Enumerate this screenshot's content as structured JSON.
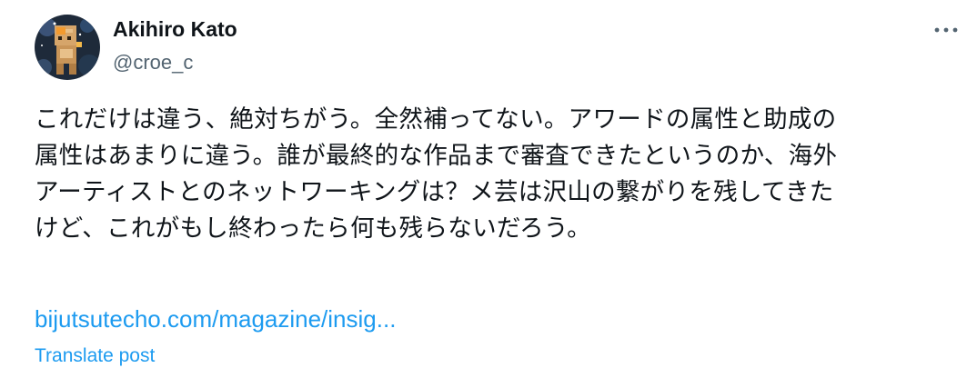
{
  "author": {
    "display_name": "Akihiro Kato",
    "handle": "@croe_c",
    "avatar_icon": "pixel-character-avatar"
  },
  "more_menu": {
    "icon": "more-horizontal-icon"
  },
  "post": {
    "text": "これだけは違う、絶対ちがう。全然補ってない。アワードの属性と助成の\n属性はあまりに違う。誰が最終的な作品まで審査できたというのか、海外\nアーティストとのネットワーキングは？メ芸は沢山の繋がりを残してきた\nけど、これがもし終わったら何も残らないだろう。",
    "link": "bijutsutecho.com/magazine/insig...",
    "translate_label": "Translate post"
  },
  "colors": {
    "text": "#0f1419",
    "secondary": "#536471",
    "link": "#1d9bf0"
  }
}
